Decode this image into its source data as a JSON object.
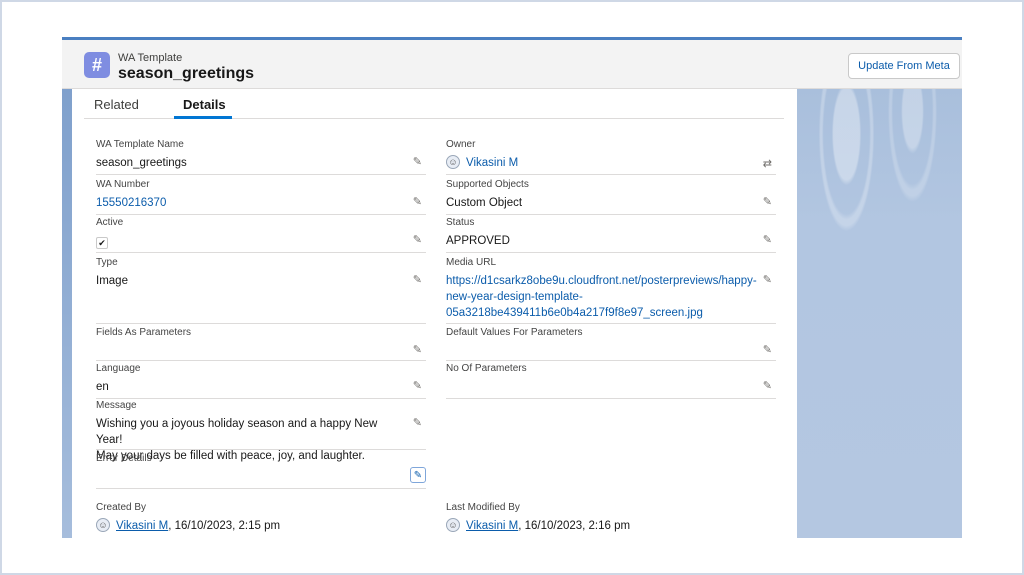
{
  "header": {
    "object_label": "WA Template",
    "record_title": "season_greetings",
    "icon": "hash-icon",
    "update_button": "Update From Meta"
  },
  "tabs": [
    {
      "label": "Related",
      "active": false
    },
    {
      "label": "Details",
      "active": true
    }
  ],
  "fields": {
    "template_name": {
      "label": "WA Template Name",
      "value": "season_greetings"
    },
    "owner": {
      "label": "Owner",
      "value": "Vikasini M"
    },
    "wa_number": {
      "label": "WA Number",
      "value": "15550216370"
    },
    "supported_objects": {
      "label": "Supported Objects",
      "value": "Custom Object"
    },
    "active": {
      "label": "Active",
      "value": "✔"
    },
    "status": {
      "label": "Status",
      "value": "APPROVED"
    },
    "type": {
      "label": "Type",
      "value": "Image"
    },
    "media_url": {
      "label": "Media URL",
      "value_lines": [
        "https://d1csarkz8obe9u.cloudfront.net/posterpreviews/happy-",
        "new-year-design-template-",
        "05a3218be439411b6e0b4a217f9f8e97_screen.jpg"
      ]
    },
    "fields_as_parameters": {
      "label": "Fields As Parameters",
      "value": ""
    },
    "default_values": {
      "label": "Default Values For Parameters",
      "value": ""
    },
    "language": {
      "label": "Language",
      "value": "en"
    },
    "no_of_parameters": {
      "label": "No Of Parameters",
      "value": ""
    },
    "message": {
      "label": "Message",
      "value_lines": [
        "Wishing you a joyous holiday season and a happy New Year!",
        "May your days be filled with peace, joy, and laughter."
      ]
    },
    "error_details": {
      "label": "Error Details",
      "value": ""
    },
    "created_by": {
      "label": "Created By",
      "user": "Vikasini M",
      "date": ", 16/10/2023, 2:15 pm"
    },
    "last_modified_by": {
      "label": "Last Modified By",
      "user": "Vikasini M",
      "date": ", 16/10/2023, 2:16 pm"
    }
  },
  "colors": {
    "accent": "#0176d3",
    "link": "#0b5cab",
    "icon_bg": "#7f8de1"
  }
}
